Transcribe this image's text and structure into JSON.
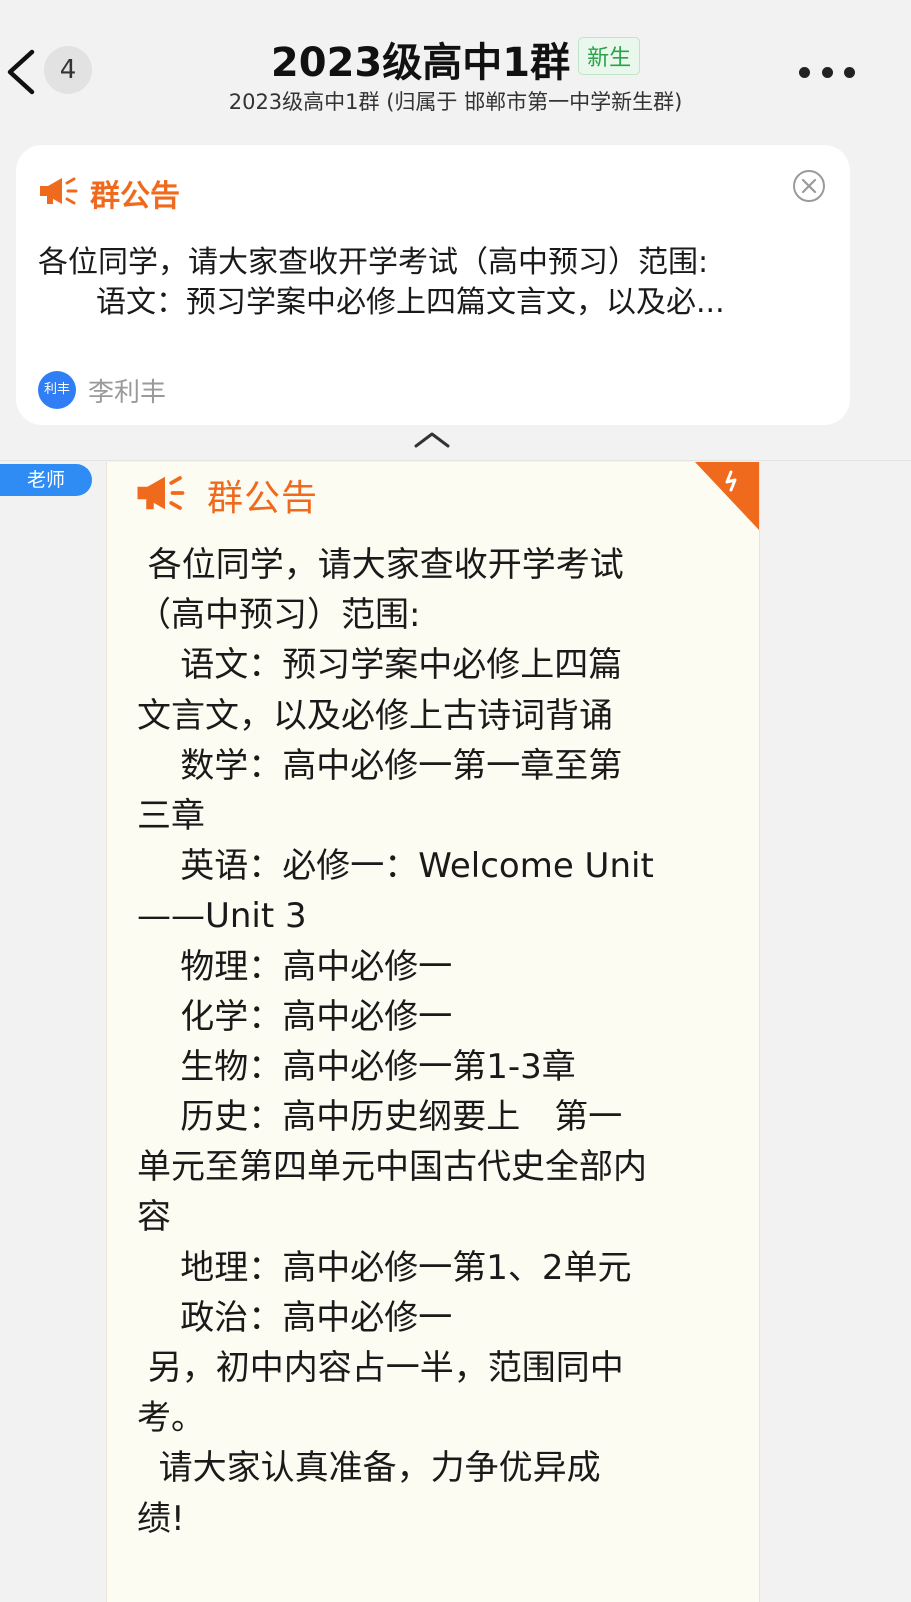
{
  "header": {
    "unread_count": "4",
    "title": "2023级高中1群",
    "badge": "新生",
    "subtitle": "2023级高中1群 (归属于 邯郸市第一中学新生群)"
  },
  "pinned": {
    "label": "群公告",
    "preview_line1": "各位同学，请大家查收开学考试（高中预习）范围:",
    "preview_line2": "语文：预习学案中必修上四篇文言文，以及必...",
    "author_avatar_text": "利丰",
    "author_name": "李利丰"
  },
  "message": {
    "role_tag": "老师",
    "notice_label": "群公告",
    "lines": [
      " 各位同学，请大家查收开学考试",
      "（高中预习）范围:",
      "    语文：预习学案中必修上四篇",
      "文言文，以及必修上古诗词背诵",
      "    数学：高中必修一第一章至第",
      "三章",
      "    英语：必修一：Welcome Unit",
      "——Unit 3",
      "    物理：高中必修一",
      "    化学：高中必修一",
      "    生物：高中必修一第1-3章",
      "    历史：高中历史纲要上　第一",
      "单元至第四单元中国古代史全部内",
      "容",
      "    地理：高中必修一第1、2单元",
      "    政治：高中必修一",
      " 另，初中内容占一半，范围同中",
      "考。",
      "  请大家认真准备，力争优异成",
      "绩!"
    ]
  },
  "colors": {
    "accent": "#f06a1e",
    "tag_blue": "#2f8cf5",
    "badge_green": "#2aa14a"
  }
}
